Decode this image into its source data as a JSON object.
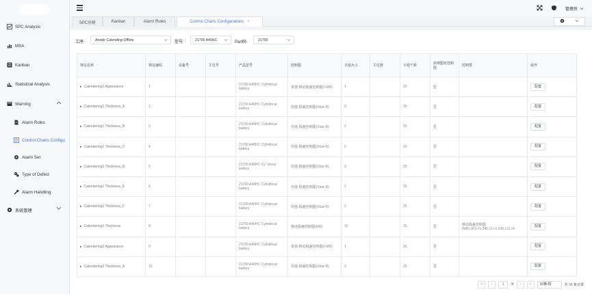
{
  "sidebar": {
    "items": [
      {
        "label": "SPC Analysis",
        "icon": "chart-icon"
      },
      {
        "label": "MSA",
        "icon": "bar-chart-icon"
      },
      {
        "label": "Kanban",
        "icon": "kanban-icon"
      },
      {
        "label": "Statistical Analysis",
        "icon": "stats-icon"
      },
      {
        "label": "Warning",
        "icon": "warning-icon"
      },
      {
        "label": "Alarm Rules",
        "icon": "doc-icon"
      },
      {
        "label": "Control Charts Configu",
        "icon": "list-icon"
      },
      {
        "label": "Alarm Set",
        "icon": "gear-group-icon"
      },
      {
        "label": "Type of Defect",
        "icon": "gears-icon"
      },
      {
        "label": "Alarm Handling",
        "icon": "tool-icon"
      },
      {
        "label": "系统管理",
        "icon": "gear-icon"
      }
    ]
  },
  "topbar": {
    "user": "管理员"
  },
  "tabs": [
    {
      "label": "SPC分析"
    },
    {
      "label": "Kanban"
    },
    {
      "label": "Alarm Rules"
    },
    {
      "label": "Control Charts Configarations"
    }
  ],
  "filters": {
    "process_label": "工序:",
    "process_value": "Anode Calending-Offline",
    "model_label": "型号:",
    "model_value": "21700 A40HC",
    "part_label": "Part码:",
    "part_value": "21700"
  },
  "table": {
    "headers": [
      "特征名称",
      "特征编码",
      "设备号",
      "工位号",
      "产品型号",
      "控制图",
      "子组大小",
      "工位数",
      "子组个数",
      "启用图定控制限",
      "控制限",
      "操作"
    ],
    "rows": [
      {
        "name": "Calendering1 Appearance",
        "code": "1",
        "product": "21700 A40HC Cylindrical battery",
        "chart": "单值-移动极差控制图(I-MR)",
        "subgroup": "1",
        "count": "25",
        "fixed": "否",
        "limit": ""
      },
      {
        "name": "Calendering1 Thickness_A",
        "code": "2",
        "product": "21700 A40HC Cylindrical battery",
        "chart": "均值-极差控制图(Xbar-R)",
        "subgroup": "2",
        "count": "25",
        "fixed": "否",
        "limit": ""
      },
      {
        "name": "Calendering1 Thickness_B",
        "code": "3",
        "product": "21700 A40HC Cylindrical battery",
        "chart": "均值-极差控制图(Xbar-R)",
        "subgroup": "2",
        "count": "25",
        "fixed": "否",
        "limit": ""
      },
      {
        "name": "Calendering1 Thickness_C",
        "code": "4",
        "product": "21700 A40HC Cylindrical battery",
        "chart": "均值-极差控制图(Xbar-R)",
        "subgroup": "2",
        "count": "25",
        "fixed": "否",
        "limit": ""
      },
      {
        "name": "Calendering1 Thickness_D",
        "code": "5",
        "product": "21700 A40HC Cy'  'drical battery",
        "chart": "均值-极差控制图(Xbar-R)",
        "subgroup": "2",
        "count": "25",
        "fixed": "否",
        "limit": ""
      },
      {
        "name": "Calendering1 Thickness_E",
        "code": "6",
        "product": "21700 A40HC Cylindrical battery",
        "chart": "均值-极差控制图(Xbar-R)",
        "subgroup": "2",
        "count": "25",
        "fixed": "否",
        "limit": ""
      },
      {
        "name": "Calendering1 Thickness_F",
        "code": "7",
        "product": "21700 A40HC Cylindrical battery",
        "chart": "均值-极差控制图(Xbar-R)",
        "subgroup": "2",
        "count": "25",
        "fixed": "否",
        "limit": ""
      },
      {
        "name": "Calendering1 Thickness",
        "code": "8",
        "product": "21700 A40HC Cylindrical battery",
        "chart": "移动极差控制图(MR)",
        "subgroup": "12",
        "count": "15",
        "fixed": "否",
        "limit": "移动极差控制图(MR):UCL=5.346,CL=1.636,LCL=0"
      },
      {
        "name": "Calendering2 Appearance",
        "code": "9",
        "product": "21700 A40HC Cylindrical battery",
        "chart": "单值-移动极差控制图(I-MR)",
        "subgroup": "1",
        "count": "25",
        "fixed": "否",
        "limit": ""
      },
      {
        "name": "Calendering2 Thickness_A",
        "code": "10",
        "product": "21700 A40HC Cylindrical battery",
        "chart": "均值-极差控制图(Xbar-R)",
        "subgroup": "2",
        "count": "25",
        "fixed": "否",
        "limit": ""
      }
    ],
    "action_label": "配置"
  },
  "pager": {
    "page": "1",
    "total_pages": "/4",
    "page_size": "10条/页",
    "total": "共 36 条记录"
  },
  "colors": {
    "accent": "#4b72e0"
  }
}
